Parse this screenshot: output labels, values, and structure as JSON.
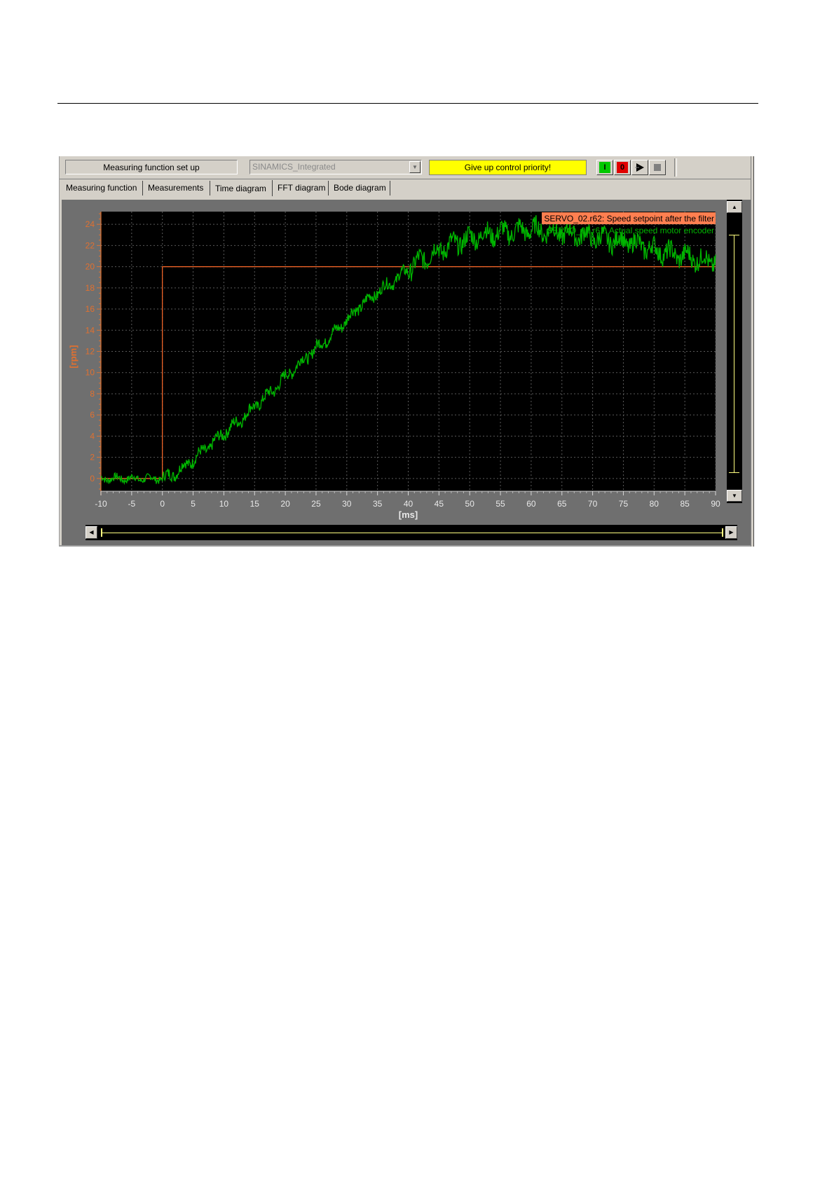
{
  "toolbar": {
    "setup_label": "Measuring function set up",
    "device_value": "SINAMICS_Integrated",
    "priority_label": "Give up control priority!",
    "on_label": "I",
    "off_label": "0"
  },
  "tabs": [
    "Measuring function",
    "Measurements",
    "Time diagram",
    "FFT diagram",
    "Bode diagram"
  ],
  "active_tab": "Time diagram",
  "chart_data": {
    "type": "line",
    "xlabel": "[ms]",
    "ylabel": "[rpm]",
    "xlim": [
      -10,
      90
    ],
    "ylim": [
      -1.2,
      25.2
    ],
    "x_ticks": [
      -10,
      -5,
      0,
      5,
      10,
      15,
      20,
      25,
      30,
      35,
      40,
      45,
      50,
      55,
      60,
      65,
      70,
      75,
      80,
      85,
      90
    ],
    "y_ticks": [
      0,
      2,
      4,
      6,
      8,
      10,
      12,
      14,
      16,
      18,
      20,
      22,
      24
    ],
    "grid": true,
    "legend_position": "top-right",
    "series": [
      {
        "name": "SERVO_02.r62: Speed setpoint after the filter",
        "color": "#ff6a2a",
        "x": [
          -10,
          0,
          0,
          90
        ],
        "y": [
          0,
          0,
          20,
          20
        ]
      },
      {
        "name": "SERVO_02.r61: Actual speed motor encoder",
        "color": "#00b400",
        "noisy": true,
        "x": [
          -10,
          -5,
          0,
          2,
          5,
          8,
          10,
          12,
          15,
          18,
          20,
          22,
          25,
          28,
          30,
          32,
          35,
          38,
          40,
          42,
          45,
          48,
          50,
          52,
          55,
          58,
          60,
          62,
          65,
          68,
          70,
          72,
          75,
          78,
          80,
          82,
          85,
          88,
          90
        ],
        "y": [
          0,
          0,
          0,
          0.5,
          1.8,
          3.2,
          4.3,
          5.2,
          6.8,
          8.3,
          9.6,
          10.7,
          12.3,
          13.8,
          15.0,
          16.2,
          17.6,
          18.8,
          19.8,
          20.6,
          21.6,
          22.3,
          22.7,
          23.0,
          23.2,
          23.4,
          23.5,
          23.4,
          23.2,
          23.0,
          22.8,
          22.6,
          22.4,
          22.0,
          21.6,
          21.3,
          21.0,
          20.6,
          20.5
        ]
      }
    ]
  }
}
